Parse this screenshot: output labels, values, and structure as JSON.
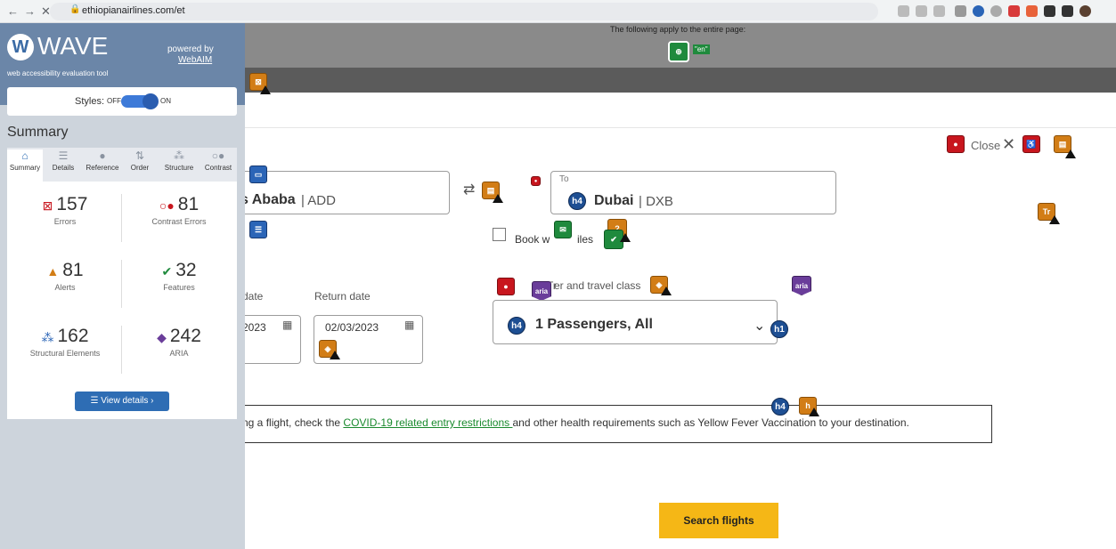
{
  "browser": {
    "back": "←",
    "forward": "→",
    "stop": "✕",
    "url": "ethiopianairlines.com/et"
  },
  "wave": {
    "brand": "WAVE",
    "tagline": "web accessibility evaluation tool",
    "powered_by": "powered by",
    "webaim": "WebAIM",
    "styles_label": "Styles:",
    "styles_off": "OFF",
    "styles_on": "ON",
    "summary_title": "Summary",
    "tabs": [
      {
        "label": "Summary",
        "icon": "home-icon"
      },
      {
        "label": "Details",
        "icon": "list-icon"
      },
      {
        "label": "Reference",
        "icon": "info-icon"
      },
      {
        "label": "Order",
        "icon": "order-icon"
      },
      {
        "label": "Structure",
        "icon": "structure-icon"
      },
      {
        "label": "Contrast",
        "icon": "contrast-icon"
      }
    ],
    "stats": {
      "errors": {
        "value": "157",
        "label": "Errors"
      },
      "contrast_errors": {
        "value": "81",
        "label": "Contrast Errors"
      },
      "alerts": {
        "value": "81",
        "label": "Alerts"
      },
      "features": {
        "value": "32",
        "label": "Features"
      },
      "structural": {
        "value": "162",
        "label": "Structural Elements"
      },
      "aria": {
        "value": "242",
        "label": "ARIA"
      }
    },
    "view_details": "View details ›"
  },
  "page": {
    "applies_text": "The following apply to the entire page:",
    "lang_badge": "\"en\"",
    "close_label": "Close",
    "from_value_bold": "s Ababa",
    "from_code": "| ADD",
    "to_label": "To",
    "to_city": "Dubai",
    "to_code": "| DXB",
    "book_with_miles": "Book w",
    "book_with_miles_tail": "iles",
    "depart_label": "date",
    "return_label": "Return date",
    "depart_value": "2023",
    "return_value": "02/03/2023",
    "passengers_label_head": "Tr",
    "passengers_label_tail": "er and travel class",
    "passengers_value": "1 Passengers, All",
    "notice_head": "ng a flight, check the ",
    "notice_link": "COVID-19 related entry restrictions ",
    "notice_tail": "and other health requirements such as Yellow Fever Vaccination to your destination.",
    "search_button": "Search flights",
    "h4_badge": "h4",
    "h1_badge": "h1",
    "aria_badge": "aria"
  }
}
